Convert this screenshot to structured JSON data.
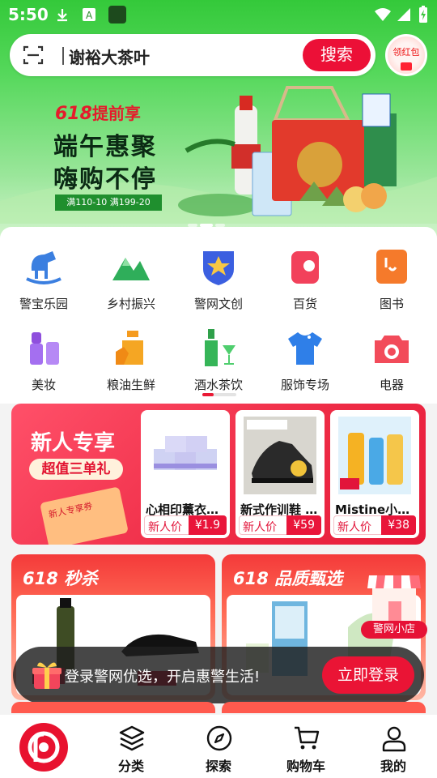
{
  "status_bar": {
    "time": "5:50"
  },
  "search": {
    "keyword": "谢裕大茶叶",
    "button": "搜索"
  },
  "red_packet": {
    "label": "领红包"
  },
  "banner": {
    "tag_618": "618",
    "tag_text": "提前享",
    "line1": "端午惠聚",
    "line2": "嗨购不停",
    "coupon": "满110-10 满199-20"
  },
  "categories": [
    {
      "label": "警宝乐园",
      "icon": "rocking-horse-icon"
    },
    {
      "label": "乡村振兴",
      "icon": "mountain-icon"
    },
    {
      "label": "警网文创",
      "icon": "badge-icon"
    },
    {
      "label": "百货",
      "icon": "tissue-icon"
    },
    {
      "label": "图书",
      "icon": "book-icon"
    },
    {
      "label": "美妆",
      "icon": "lipstick-icon"
    },
    {
      "label": "粮油生鲜",
      "icon": "oil-bottle-icon"
    },
    {
      "label": "酒水茶饮",
      "icon": "wine-icon"
    },
    {
      "label": "服饰专场",
      "icon": "tshirt-icon"
    },
    {
      "label": "电器",
      "icon": "camera-icon"
    }
  ],
  "new_user": {
    "title": "新人专享",
    "subtitle": "超值三单礼",
    "coupon_box": "新人专享券",
    "products": [
      {
        "name": "心相印薰衣…",
        "tag": "新人价",
        "price": "¥1.9"
      },
      {
        "name": "新式作训鞋 …",
        "tag": "新人价",
        "price": "¥59"
      },
      {
        "name": "Mistine小…",
        "tag": "新人价",
        "price": "¥38"
      }
    ]
  },
  "promos": [
    {
      "title": "618 秒杀"
    },
    {
      "title": "618 品质甄选"
    }
  ],
  "shop_badge": {
    "label": "警网小店"
  },
  "login_bar": {
    "text": "登录警网优选，开启惠警生活!",
    "button": "立即登录"
  },
  "tabbar": [
    {
      "label": "",
      "icon": "app-logo-icon"
    },
    {
      "label": "分类",
      "icon": "layers-icon"
    },
    {
      "label": "探索",
      "icon": "compass-icon"
    },
    {
      "label": "购物车",
      "icon": "cart-icon"
    },
    {
      "label": "我的",
      "icon": "user-icon"
    }
  ],
  "colors": {
    "brand_red": "#ea1435",
    "header_green": "#34c93a"
  }
}
